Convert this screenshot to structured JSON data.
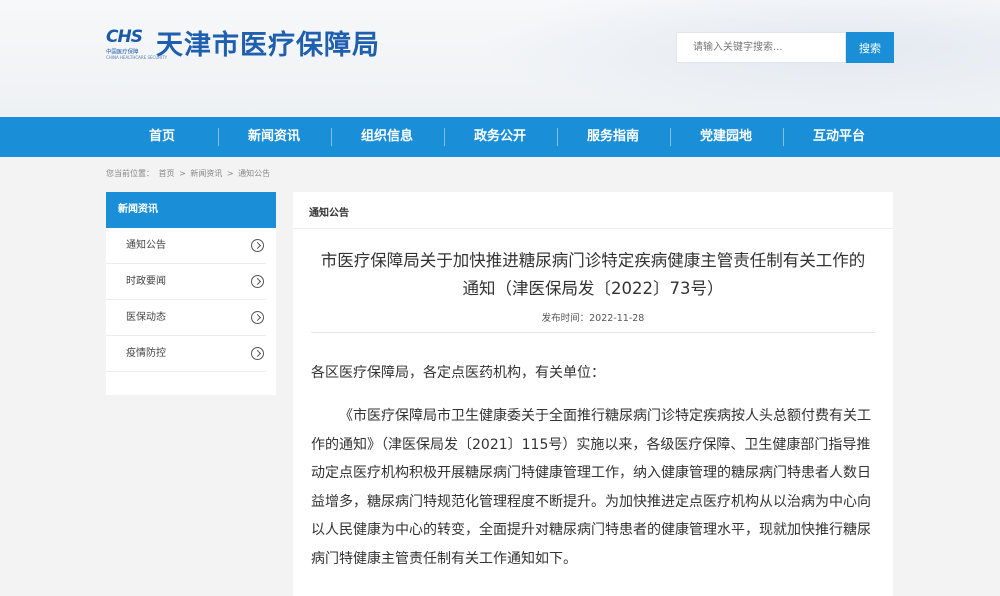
{
  "header": {
    "logo_abbr": "CHS",
    "logo_sub": "中国医疗保障",
    "logo_sub_en": "CHINA HEALTHCARE SECURITY",
    "site_title": "天津市医疗保障局"
  },
  "search": {
    "placeholder": "请输入关键字搜索...",
    "button_label": "搜索"
  },
  "nav": {
    "items": [
      "首页",
      "新闻资讯",
      "组织信息",
      "政务公开",
      "服务指南",
      "党建园地",
      "互动平台"
    ]
  },
  "breadcrumb": {
    "prefix": "您当前位置：",
    "items": [
      "首页",
      "新闻资讯",
      "通知公告"
    ],
    "separator": ">"
  },
  "sidebar": {
    "title": "新闻资讯",
    "items": [
      "通知公告",
      "时政要闻",
      "医保动态",
      "疫情防控"
    ]
  },
  "main": {
    "tab_label": "通知公告",
    "title_line1": "市医疗保障局关于加快推进糖尿病门诊特定疾病健康主管责任制有关工作的",
    "title_line2": "通知（津医保局发〔2022〕73号）",
    "date_label": "发布时间：",
    "date_value": "2022-11-28",
    "salutation": "各区医疗保障局，各定点医药机构，有关单位：",
    "paragraph": "《市医疗保障局市卫生健康委关于全面推行糖尿病门诊特定疾病按人头总额付费有关工作的通知》（津医保局发〔2021〕115号）实施以来，各级医疗保障、卫生健康部门指导推动定点医疗机构积极开展糖尿病门特健康管理工作，纳入健康管理的糖尿病门特患者人数日益增多，糖尿病门特规范化管理程度不断提升。为加快推进定点医疗机构从以治病为中心向以人民健康为中心的转变，全面提升对糖尿病门特患者的健康管理水平，现就加快推行糖尿病门特健康主管责任制有关工作通知如下。"
  },
  "colors": {
    "brand_blue": "#1a8fd8",
    "title_blue": "#1f5fb0"
  }
}
